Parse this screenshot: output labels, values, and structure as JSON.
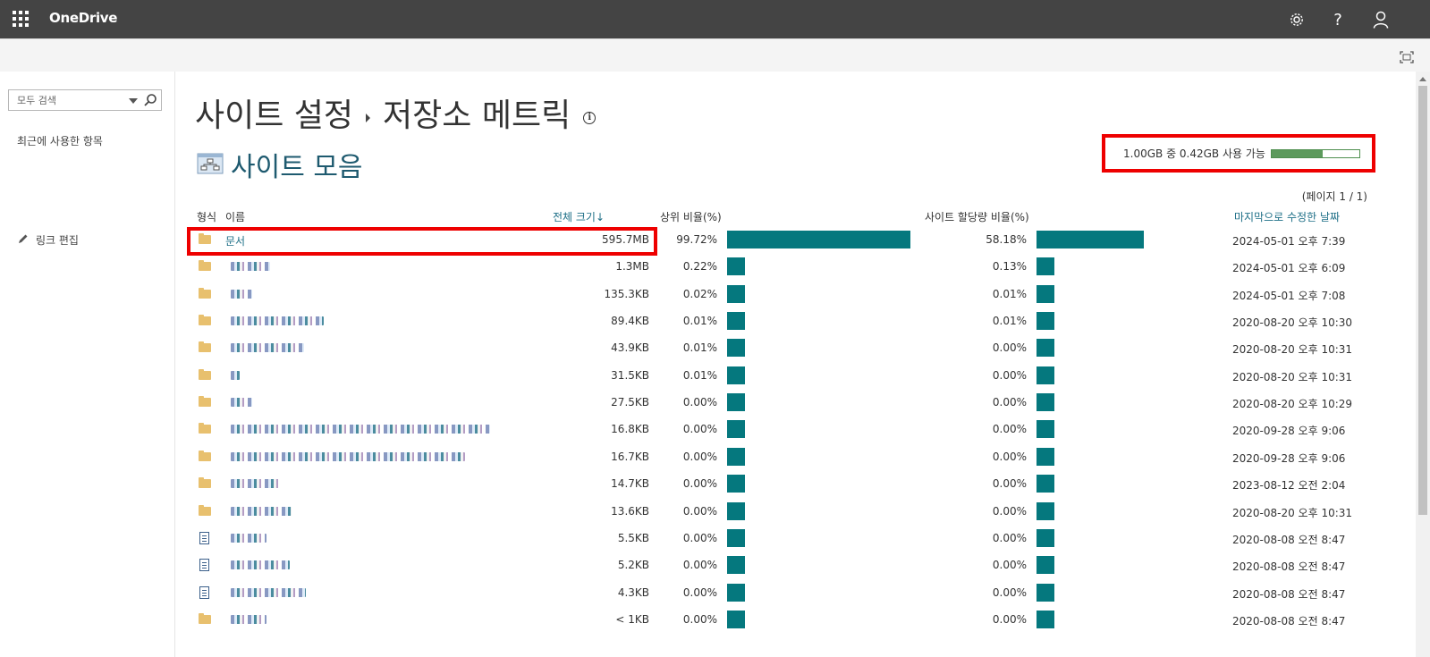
{
  "app": {
    "title": "OneDrive"
  },
  "topbar": {
    "settings_icon": "gear-icon",
    "help_icon": "question-icon",
    "help_glyph": "?",
    "account_icon": "person-icon"
  },
  "leftnav": {
    "search_placeholder": "모두 검색",
    "recent": "최근에 사용한 항목",
    "edit_links": "링크 편집"
  },
  "page": {
    "crumb_1": "사이트 설정",
    "crumb_2": "저장소 메트릭",
    "info_glyph": "i",
    "subtitle": "사이트 모음",
    "quota_text": "1.00GB 중 0.42GB 사용 가능",
    "quota_used_fraction": 0.58,
    "pager": "(페이지 1 / 1)"
  },
  "table": {
    "headers": {
      "type": "형식",
      "name": "이름",
      "size": "전체 크기↓",
      "parent_pct": "상위 비율(%)",
      "site_pct": "사이트 할당량 비율(%)",
      "modified": "마지막으로 수정한 날짜"
    },
    "rows": [
      {
        "icon": "folder",
        "name": "문서",
        "size": "595.7MB",
        "parent": "99.72%",
        "site": "58.18%",
        "parent_val": 99.72,
        "site_val": 58.18,
        "date": "2024-05-01 오후 7:39"
      },
      {
        "icon": "folder",
        "name": "",
        "size": "1.3MB",
        "parent": "0.22%",
        "site": "0.13%",
        "parent_val": 0.22,
        "site_val": 0.13,
        "date": "2024-05-01 오후 6:09"
      },
      {
        "icon": "folder",
        "name": "",
        "size": "135.3KB",
        "parent": "0.02%",
        "site": "0.01%",
        "parent_val": 0.02,
        "site_val": 0.01,
        "date": "2024-05-01 오후 7:08"
      },
      {
        "icon": "folder",
        "name": "",
        "size": "89.4KB",
        "parent": "0.01%",
        "site": "0.01%",
        "parent_val": 0.01,
        "site_val": 0.01,
        "date": "2020-08-20 오후 10:30"
      },
      {
        "icon": "folder",
        "name": "",
        "size": "43.9KB",
        "parent": "0.01%",
        "site": "0.00%",
        "parent_val": 0.01,
        "site_val": 0.0,
        "date": "2020-08-20 오후 10:31"
      },
      {
        "icon": "folder",
        "name": "",
        "size": "31.5KB",
        "parent": "0.01%",
        "site": "0.00%",
        "parent_val": 0.01,
        "site_val": 0.0,
        "date": "2020-08-20 오후 10:31"
      },
      {
        "icon": "folder",
        "name": "",
        "size": "27.5KB",
        "parent": "0.00%",
        "site": "0.00%",
        "parent_val": 0.0,
        "site_val": 0.0,
        "date": "2020-08-20 오후 10:29"
      },
      {
        "icon": "folder",
        "name": "",
        "size": "16.8KB",
        "parent": "0.00%",
        "site": "0.00%",
        "parent_val": 0.0,
        "site_val": 0.0,
        "date": "2020-09-28 오후 9:06"
      },
      {
        "icon": "folder",
        "name": "",
        "size": "16.7KB",
        "parent": "0.00%",
        "site": "0.00%",
        "parent_val": 0.0,
        "site_val": 0.0,
        "date": "2020-09-28 오후 9:06"
      },
      {
        "icon": "folder",
        "name": "",
        "size": "14.7KB",
        "parent": "0.00%",
        "site": "0.00%",
        "parent_val": 0.0,
        "site_val": 0.0,
        "date": "2023-08-12 오전 2:04"
      },
      {
        "icon": "folder",
        "name": "",
        "size": "13.6KB",
        "parent": "0.00%",
        "site": "0.00%",
        "parent_val": 0.0,
        "site_val": 0.0,
        "date": "2020-08-20 오후 10:31"
      },
      {
        "icon": "doc",
        "name": "",
        "size": "5.5KB",
        "parent": "0.00%",
        "site": "0.00%",
        "parent_val": 0.0,
        "site_val": 0.0,
        "date": "2020-08-08 오전 8:47"
      },
      {
        "icon": "doc",
        "name": "",
        "size": "5.2KB",
        "parent": "0.00%",
        "site": "0.00%",
        "parent_val": 0.0,
        "site_val": 0.0,
        "date": "2020-08-08 오전 8:47"
      },
      {
        "icon": "doc",
        "name": "",
        "size": "4.3KB",
        "parent": "0.00%",
        "site": "0.00%",
        "parent_val": 0.0,
        "site_val": 0.0,
        "date": "2020-08-08 오전 8:47"
      },
      {
        "icon": "folder",
        "name": "",
        "size": "< 1KB",
        "parent": "0.00%",
        "site": "0.00%",
        "parent_val": 0.0,
        "site_val": 0.0,
        "date": "2020-08-08 오전 8:47"
      }
    ]
  },
  "colors": {
    "topbar": "#444444",
    "accent": "#1e6f87",
    "bar": "#05787e",
    "highlight": "#ee0000",
    "quota": "#5c9a5c"
  }
}
